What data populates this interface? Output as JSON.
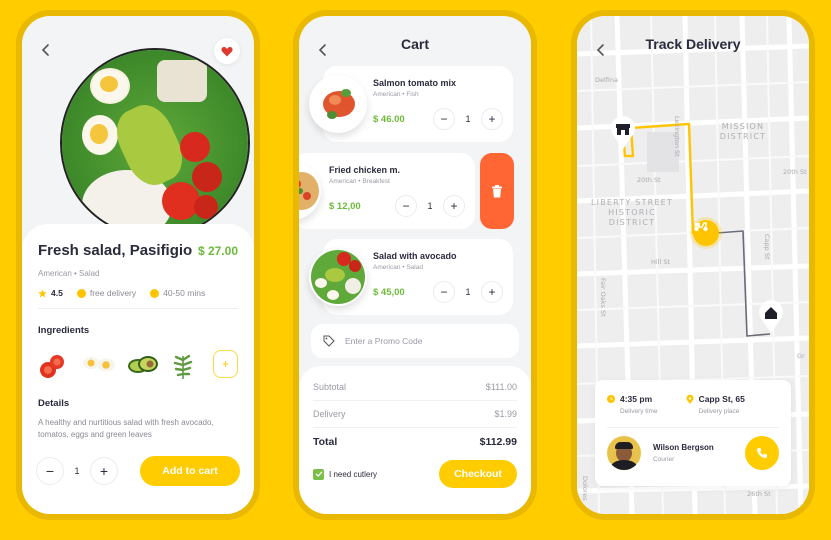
{
  "product": {
    "title": "Fresh salad, Pasifigio",
    "price": "$ 27.00",
    "subtitle": "American • Salad",
    "rating": "4.5",
    "delivery": "free delivery",
    "time": "40-50 mins",
    "ingredients_heading": "Ingredients",
    "ingredients": [
      "tomato",
      "egg",
      "avocado",
      "arugula"
    ],
    "add_ingredient_label": "+",
    "details_heading": "Details",
    "details_text": "A healthy and nurtitious salad with fresh avocado, tomatos, eggs and green leaves",
    "quantity": "1",
    "minus": "−",
    "plus": "+",
    "add_to_cart": "Add to cart",
    "favorite": true
  },
  "cart": {
    "title": "Cart",
    "items": [
      {
        "name": "Salmon tomato mix",
        "sub": "American • Fish",
        "price": "$ 46.00",
        "qty": "1"
      },
      {
        "name": "Fried chicken m.",
        "sub": "American • Breakfest",
        "price": "$ 12,00",
        "qty": "1"
      },
      {
        "name": "Salad with avocado",
        "sub": "American • Salad",
        "price": "$ 45,00",
        "qty": "1"
      }
    ],
    "minus": "−",
    "plus": "+",
    "promo_placeholder": "Enter a Promo Code",
    "subtotal_label": "Subtotal",
    "subtotal": "$111.00",
    "delivery_label": "Delivery",
    "delivery": "$1.99",
    "total_label": "Total",
    "total": "$112.99",
    "cutlery_label": "I need cutlery",
    "cutlery_checked": true,
    "checkout": "Checkout"
  },
  "tracking": {
    "title": "Track Delivery",
    "map_labels": {
      "delfina": "Delfina",
      "lexington": "Lexington St",
      "mission": "MISSION DISTRICT",
      "twentieth_1": "20th St",
      "twentieth_2": "20th St",
      "liberty": "LIBERTY STREET HISTORIC DISTRICT",
      "capp": "Capp St",
      "hill": "Hill St",
      "fair_oaks": "Fair Oaks St",
      "gr": "Gr",
      "twentysixth": "26th St",
      "dolores": "Dolores"
    },
    "delivery_time": "4:35 pm",
    "delivery_time_label": "Delivery time",
    "delivery_place": "Capp St, 65",
    "delivery_place_label": "Delivery place",
    "courier_name": "Wilson Bergson",
    "courier_role": "Courier"
  },
  "colors": {
    "background": "#FFCC00",
    "frame": "#E9B800",
    "accent": "#FFCC00",
    "price_green": "#6DBB3A",
    "delete_orange": "#FF6633",
    "text_dark": "#2A2B3C"
  }
}
